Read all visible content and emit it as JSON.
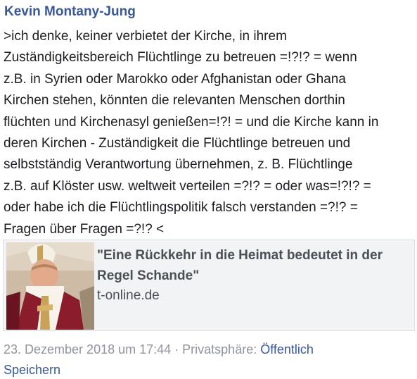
{
  "post": {
    "author": "Kevin Montany-Jung",
    "body_lines": [
      ">ich denke, keiner verbietet der Kirche, in ihrem",
      "Zuständigkeitsbereich Flüchtlinge zu betreuen =!?!? = wenn",
      "z.B.  in Syrien oder Marokko oder Afghanistan oder Ghana",
      "Kirchen stehen, könnten die relevanten Menschen dorthin",
      "flüchten und Kirchenasyl genießen=!?! = und die Kirche kann in",
      "deren Kirchen - Zuständigkeit die Flüchtlinge betreuen und",
      "selbstständig Verantwortung übernehmen, z. B. Flüchtlinge",
      "z.B.  auf Klöster usw. weltweit verteilen =?!? = oder was=!?!? =",
      "oder habe ich die Flüchtlingspolitik falsch verstanden =?!? =",
      "Fragen über Fragen  =?!? <"
    ]
  },
  "link_card": {
    "title": "\"Eine Rückkehr in die Heimat bedeutet  in der Regel Schande\"",
    "domain": "t-online.de",
    "thumbnail_icon": "article-thumbnail-image"
  },
  "meta": {
    "date": "23. Dezember  2018 um 17:44",
    "separator": " · ",
    "privacy_label": "Privatsphäre: ",
    "privacy_value": "Öffentlich"
  },
  "actions": {
    "save_label": "Speichern"
  },
  "colors": {
    "link_blue": "#385898",
    "meta_gray": "#90949c",
    "text": "#1c1e21",
    "card_bg": "#f2f3f5"
  }
}
